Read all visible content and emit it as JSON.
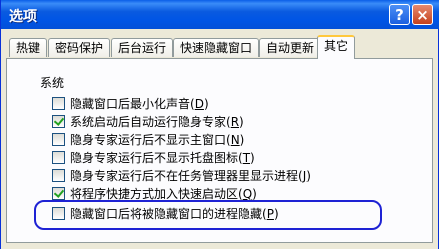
{
  "window": {
    "title": "选项"
  },
  "titlebar": {
    "help_icon": "help-icon",
    "close_icon": "close-icon",
    "help_glyph": "?",
    "close_glyph": "×"
  },
  "tabs": [
    {
      "label": "热键",
      "active": false
    },
    {
      "label": "密码保护",
      "active": false
    },
    {
      "label": "后台运行",
      "active": false
    },
    {
      "label": "快速隐藏窗口",
      "active": false
    },
    {
      "label": "自动更新",
      "active": false
    },
    {
      "label": "其它",
      "active": true
    }
  ],
  "section": {
    "title": "系统"
  },
  "options": [
    {
      "text": "隐藏窗口后最小化声音(",
      "hotkey": "D",
      "suffix": ")",
      "checked": false
    },
    {
      "text": "系统启动后自动运行隐身专家(",
      "hotkey": "R",
      "suffix": ")",
      "checked": true
    },
    {
      "text": "隐身专家运行后不显示主窗口(",
      "hotkey": "N",
      "suffix": ")",
      "checked": false
    },
    {
      "text": "隐身专家运行后不显示托盘图标(",
      "hotkey": "T",
      "suffix": ")",
      "checked": false
    },
    {
      "text": "隐身专家运行后不在任务管理器里显示进程(",
      "hotkey": "J",
      "suffix": ")",
      "checked": false
    },
    {
      "text": "将程序快捷方式加入快速启动区(",
      "hotkey": "Q",
      "suffix": ")",
      "checked": true
    },
    {
      "text": "隐藏窗口后将被隐藏窗口的进程隐藏(",
      "hotkey": "P",
      "suffix": ")",
      "checked": false
    }
  ],
  "colors": {
    "titlebar": "#0055e5",
    "highlight_ring": "#1e22d4",
    "active_tab_accent": "#ffc83c"
  }
}
